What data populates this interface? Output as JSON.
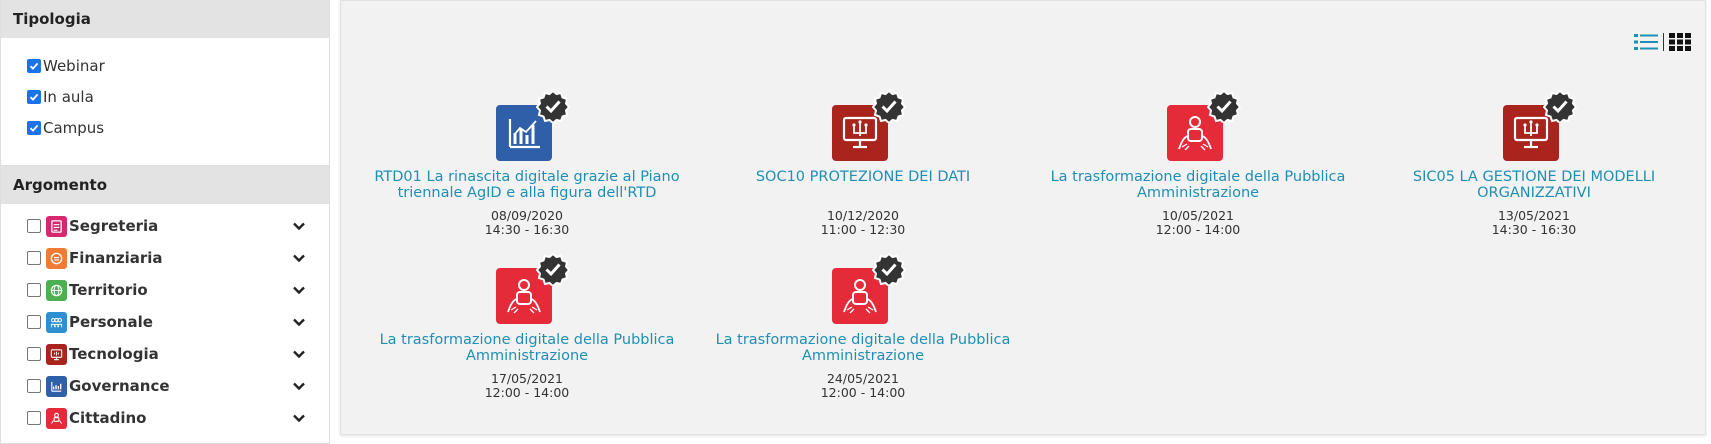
{
  "filters": {
    "tipologia": {
      "title": "Tipologia",
      "options": [
        {
          "label": "Webinar",
          "checked": true
        },
        {
          "label": "In aula",
          "checked": true
        },
        {
          "label": "Campus",
          "checked": true
        }
      ]
    },
    "argomento": {
      "title": "Argomento",
      "items": [
        {
          "label": "Segreteria",
          "icon": "document-icon",
          "color": "#d6286e"
        },
        {
          "label": "Finanziaria",
          "icon": "coins-icon",
          "color": "#f07b35"
        },
        {
          "label": "Territorio",
          "icon": "globe-icon",
          "color": "#4caf50"
        },
        {
          "label": "Personale",
          "icon": "people-icon",
          "color": "#2e8fd1"
        },
        {
          "label": "Tecnologia",
          "icon": "monitor-icon",
          "color": "#a8241c"
        },
        {
          "label": "Governance",
          "icon": "chart-icon",
          "color": "#2f5fa8"
        },
        {
          "label": "Cittadino",
          "icon": "citizen-icon",
          "color": "#e52b3a"
        }
      ]
    }
  },
  "courses": [
    {
      "title": "RTD01 La rinascita digitale grazie al Piano triennale AgID e alla figura dell'RTD",
      "date": "08/09/2020",
      "time": "14:30 - 16:30",
      "icon": "chart-icon",
      "color": "#2f5fa8"
    },
    {
      "title": "SOC10 PROTEZIONE DEI DATI",
      "date": "10/12/2020",
      "time": "11:00 - 12:30",
      "icon": "monitor-icon",
      "color": "#a8241c"
    },
    {
      "title": "La trasformazione digitale della Pubblica Amministrazione",
      "date": "10/05/2021",
      "time": "12:00 - 14:00",
      "icon": "citizen-icon",
      "color": "#e52b3a"
    },
    {
      "title": "SIC05 LA GESTIONE DEI MODELLI ORGANIZZATIVI",
      "date": "13/05/2021",
      "time": "14:30 - 16:30",
      "icon": "monitor-icon",
      "color": "#a8241c"
    },
    {
      "title": "La trasformazione digitale della Pubblica Amministrazione",
      "date": "17/05/2021",
      "time": "12:00 - 14:00",
      "icon": "citizen-icon",
      "color": "#e52b3a"
    },
    {
      "title": "La trasformazione digitale della Pubblica Amministrazione",
      "date": "24/05/2021",
      "time": "12:00 - 14:00",
      "icon": "citizen-icon",
      "color": "#e52b3a"
    }
  ],
  "view_toggle": {
    "list_icon": "list-view-icon",
    "grid_icon": "grid-view-icon",
    "list_color": "#1f8fb5",
    "grid_color": "#111111"
  }
}
